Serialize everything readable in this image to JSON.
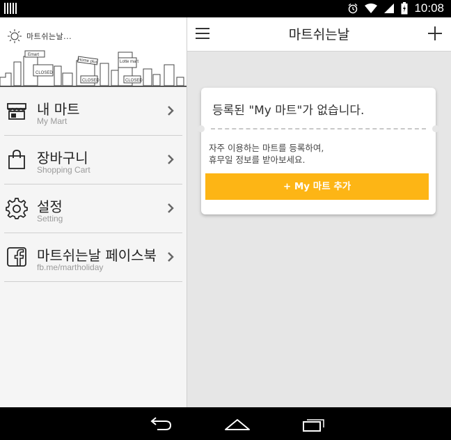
{
  "status_bar": {
    "time": "10:08",
    "icons": [
      "alarm-icon",
      "wifi-icon",
      "signal-icon",
      "battery-charging-icon"
    ]
  },
  "drawer": {
    "logo_text": "마트쉬는날...",
    "city_signs": [
      "Emart",
      "CLOSED",
      "Home plus",
      "CLOSED",
      "Lotte mart",
      "CLOSED"
    ],
    "items": [
      {
        "title": "내 마트",
        "subtitle": "My Mart",
        "icon": "store-icon"
      },
      {
        "title": "장바구니",
        "subtitle": "Shopping Cart",
        "icon": "shopping-bag-icon"
      },
      {
        "title": "설정",
        "subtitle": "Setting",
        "icon": "gear-icon"
      },
      {
        "title": "마트쉬는날 페이스북",
        "subtitle": "fb.me/martholiday",
        "icon": "facebook-icon"
      }
    ]
  },
  "topbar": {
    "title": "마트쉬는날"
  },
  "card": {
    "headline": "등록된 \"My 마트\"가 없습니다.",
    "desc_line1": "자주 이용하는 마트를 등록하여,",
    "desc_line2": "휴무일 정보를 받아보세요.",
    "button": "+ My 마트 추가"
  },
  "colors": {
    "accent": "#fdb515",
    "drawer_bg": "#f5f5f5",
    "main_bg": "#e6e6e6"
  }
}
